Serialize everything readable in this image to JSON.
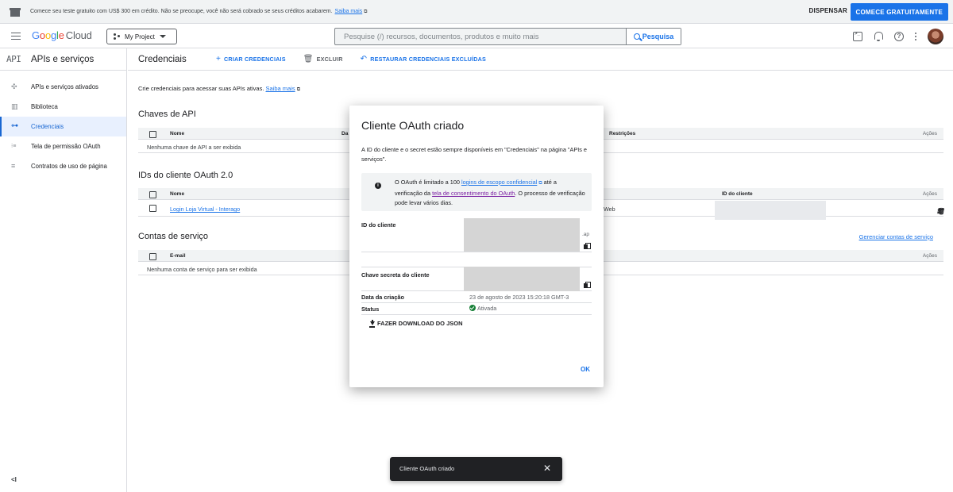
{
  "promo": {
    "message": "Comece seu teste gratuito com US$ 300 em crédito. Não se preocupe, você não será cobrado se seus créditos acabarem.",
    "link": "Saiba mais",
    "dismiss": "DISPENSAR",
    "start": "COMECE GRATUITAMENTE"
  },
  "topbar": {
    "logo": {
      "g1": "G",
      "g2": "o",
      "g3": "o",
      "g4": "g",
      "g5": "l",
      "g6": "e",
      "cloud": "Cloud"
    },
    "project": "My Project",
    "search_placeholder": "Pesquise (/) recursos, documentos, produtos e muito mais",
    "search_button": "Pesquisa"
  },
  "sidebar": {
    "badge": "API",
    "title": "APIs e serviços",
    "items": [
      {
        "label": "APIs e serviços ativados",
        "icon": "diamond-icon"
      },
      {
        "label": "Biblioteca",
        "icon": "library-icon"
      },
      {
        "label": "Credenciais",
        "icon": "key-icon"
      },
      {
        "label": "Tela de permissão OAuth",
        "icon": "consent-icon"
      },
      {
        "label": "Contratos de uso de página",
        "icon": "agreement-icon"
      }
    ],
    "collapse": "<I"
  },
  "main": {
    "title": "Credenciais",
    "create": "CRIAR CREDENCIAIS",
    "delete": "EXCLUIR",
    "restore": "RESTAURAR CREDENCIAIS EXCLUÍDAS",
    "intro": "Crie credenciais para acessar suas APIs ativas.",
    "intro_link": "Saiba mais",
    "api_keys": {
      "title": "Chaves de API",
      "cols": {
        "name": "Nome",
        "date": "Da",
        "restrictions": "Restrições",
        "actions": "Ações"
      },
      "empty": "Nenhuma chave de API a ser exibida"
    },
    "oauth": {
      "title": "IDs do cliente OAuth 2.0",
      "cols": {
        "name": "Nome",
        "client_id": "ID do cliente",
        "actions": "Ações"
      },
      "rows": [
        {
          "name": "Login Loja Virtual - Interago",
          "type": "Web"
        }
      ]
    },
    "service": {
      "title": "Contas de serviço",
      "manage": "Gerenciar contas de serviço",
      "cols": {
        "email": "E-mail",
        "actions": "Ações"
      },
      "empty": "Nenhuma conta de serviço para ser exibida"
    }
  },
  "dialog": {
    "title": "Cliente OAuth criado",
    "desc": "A ID do cliente e o secret estão sempre disponíveis em \"Credenciais\" na página \"APIs e serviços\".",
    "info": {
      "p1": "O OAuth é limitado a 100 ",
      "link1": "logins de escopo confidencial",
      "p2": " até a verificação da ",
      "link2": "tela de consentimento do OAuth",
      "p3": ". O processo de verificação pode levar vários dias."
    },
    "client_id_label": "ID do cliente",
    "client_id_suffix": ".ap",
    "secret_label": "Chave secreta do cliente",
    "created_label": "Data da criação",
    "created_value": "23 de agosto de 2023 15:20:18 GMT-3",
    "status_label": "Status",
    "status_value": "Ativada",
    "download": "FAZER DOWNLOAD DO JSON",
    "ok": "OK"
  },
  "snackbar": {
    "text": "Cliente OAuth criado",
    "close": "✕"
  }
}
